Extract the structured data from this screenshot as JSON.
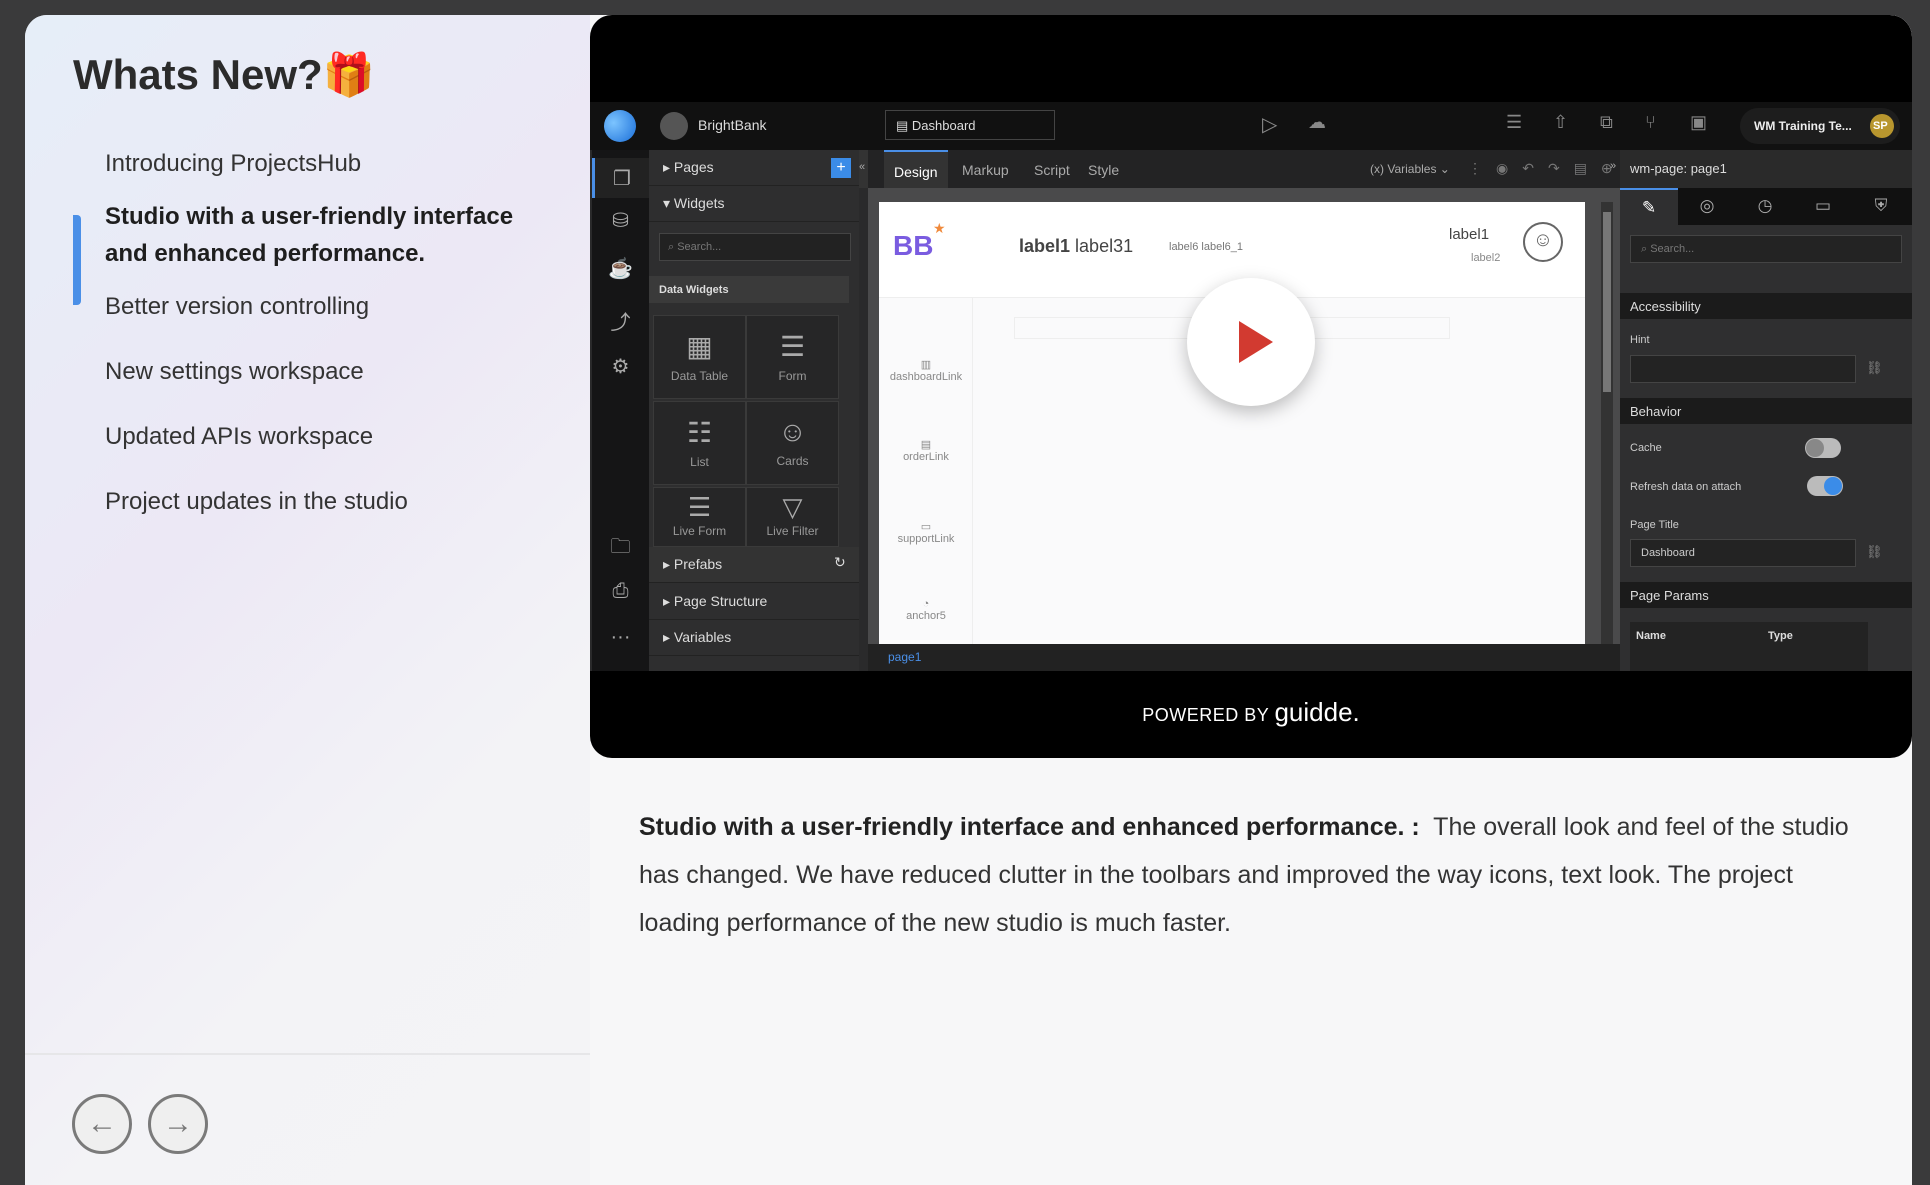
{
  "sidebar": {
    "title": "Whats New?",
    "title_icon": "🎁",
    "items": [
      {
        "label": "Introducing ProjectsHub",
        "active": false
      },
      {
        "label": "Studio with a user-friendly interface and enhanced performance.",
        "active": true
      },
      {
        "label": "Better version controlling",
        "active": false
      },
      {
        "label": "New settings workspace",
        "active": false
      },
      {
        "label": "Updated APIs workspace",
        "active": false
      },
      {
        "label": "Project updates in the studio",
        "active": false
      }
    ],
    "prev_icon": "←",
    "next_icon": "→",
    "accent": "#4a8fe7"
  },
  "video": {
    "powered_by": "POWERED BY",
    "brand": "guidde.",
    "app": {
      "project": "BrightBank",
      "page_selector": "Dashboard",
      "user": "WM Training Te...",
      "avatar": "SP",
      "panel": {
        "pages": "Pages",
        "widgets": "Widgets",
        "search_placeholder": "Search...",
        "data_widgets": "Data Widgets",
        "tiles": [
          "Data Table",
          "Form",
          "List",
          "Cards",
          "Live Form",
          "Live Filter"
        ],
        "prefabs": "Prefabs",
        "page_structure": "Page Structure",
        "variables": "Variables"
      },
      "tabs": [
        "Design",
        "Markup",
        "Script",
        "Style"
      ],
      "variables_menu": "Variables",
      "canvas": {
        "logo": "BB",
        "labels": [
          "label1",
          "label31",
          "label6 label6_1",
          "label1",
          "label2"
        ],
        "nav_links": [
          "dashboardLink",
          "orderLink",
          "supportLink",
          "anchor5"
        ],
        "page_tab": "page1"
      },
      "props": {
        "header": "wm-page: page1",
        "search_placeholder": "Search...",
        "accessibility": "Accessibility",
        "hint": "Hint",
        "behavior": "Behavior",
        "cache": "Cache",
        "cache_on": false,
        "refresh": "Refresh data on attach",
        "refresh_on": true,
        "page_title_label": "Page Title",
        "page_title_value": "Dashboard",
        "page_params": "Page Params",
        "col_name": "Name",
        "col_type": "Type"
      }
    }
  },
  "description": {
    "heading": "Studio with a user-friendly interface and enhanced performance. :",
    "body": "The overall look and feel of the studio has changed. We have reduced clutter in the toolbars and improved the way icons, text look. The project loading performance of the new studio is much faster."
  }
}
